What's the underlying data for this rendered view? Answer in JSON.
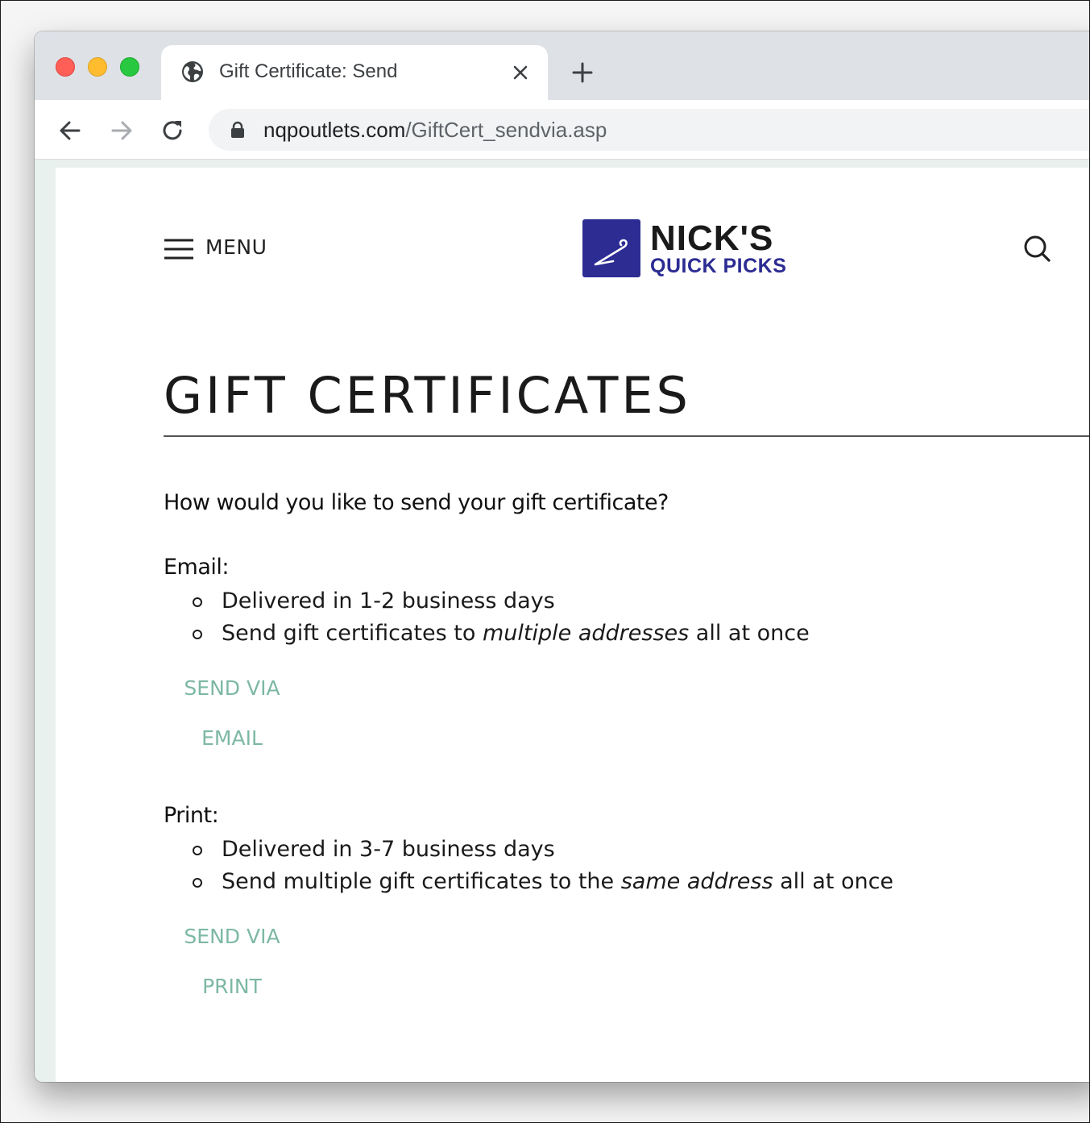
{
  "browser": {
    "tab_title": "Gift Certificate: Send",
    "url_host": "nqpoutlets.com",
    "url_path": "/GiftCert_sendvia.asp"
  },
  "site": {
    "menu_label": "MENU",
    "logo_line1": "NICK'S",
    "logo_line2": "QUICK PICKS",
    "brand_color": "#2c2c93",
    "accent_color": "#7db8a5"
  },
  "main": {
    "title": "GIFT CERTIFICATES",
    "question": "How would you like to send your gift certificate?",
    "options": [
      {
        "label": "Email:",
        "bullets": [
          {
            "before": "Delivered in 1-2 business days",
            "em": "",
            "after": ""
          },
          {
            "before": "Send gift certificates to ",
            "em": "multiple addresses",
            "after": " all at once"
          }
        ],
        "button_line1": "SEND VIA",
        "button_line2": "EMAIL"
      },
      {
        "label": "Print:",
        "bullets": [
          {
            "before": "Delivered in 3-7 business days",
            "em": "",
            "after": ""
          },
          {
            "before": "Send multiple gift certificates to the ",
            "em": "same address",
            "after": " all at once"
          }
        ],
        "button_line1": "SEND VIA",
        "button_line2": "PRINT"
      }
    ]
  }
}
